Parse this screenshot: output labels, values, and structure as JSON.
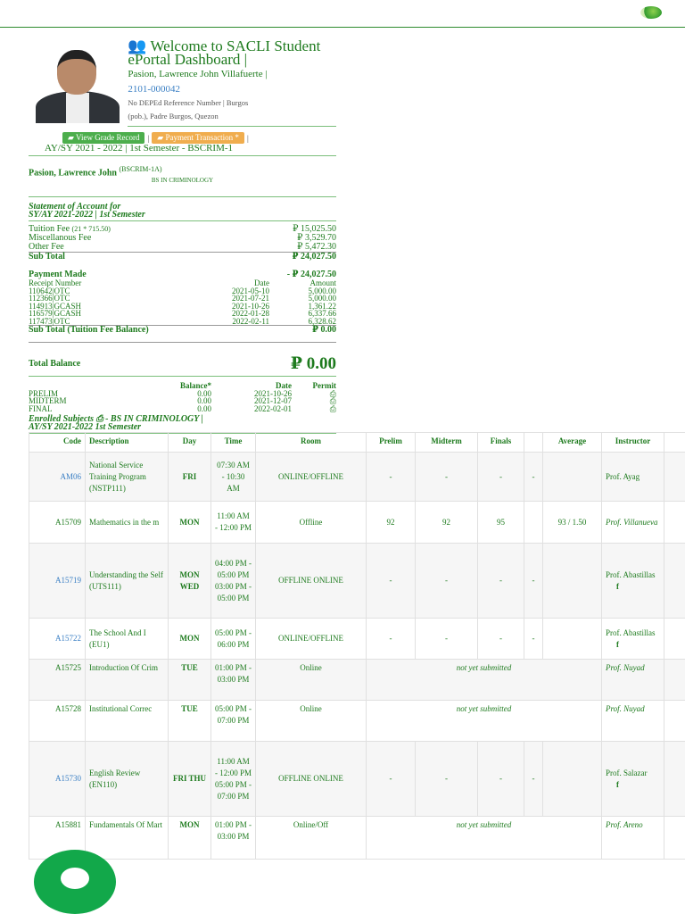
{
  "header": {
    "logo": "SACLI logo"
  },
  "profile": {
    "welcome": "Welcome to SACLI Student ePortal Dashboard |",
    "name": "Pasion, Lawrence John Villafuerte |",
    "student_id": "2101-000042",
    "address_line1": "No DEPEd Reference Number | Burgos",
    "address_line2": "(pob.), Padre Burgos, Quezon"
  },
  "buttons": {
    "grade": "View Grade Record",
    "payment": "Payment Transaction *"
  },
  "ay": "AY/SY 2021 - 2022 | 1st Semester - BSCRIM-1",
  "student": {
    "name": "Pasion, Lawrence John",
    "section": "(BSCRIM-1A)",
    "course": "BS IN CRIMINOLOGY"
  },
  "soa": {
    "title1": "Statement of Account for",
    "title2": "SY/AY 2021-2022 | 1st Semester",
    "fees": [
      {
        "label": "Tuition Fee",
        "note": "(21 * 715.50)",
        "amount": "₽ 15,025.50"
      },
      {
        "label": "Miscellanous Fee",
        "note": "",
        "amount": "₽ 3,529.70"
      },
      {
        "label": "Other Fee",
        "note": "",
        "amount": "₽ 5,472.30"
      }
    ],
    "subtotal_label": "Sub Total",
    "subtotal": "₽ 24,027.50",
    "payment_label": "Payment Made",
    "payment_total": "-  ₽ 24,027.50",
    "payment_headers": [
      "Receipt Number",
      "Date",
      "Amount"
    ],
    "payments": [
      [
        "110642|OTC",
        "2021-05-10",
        "5,000.00"
      ],
      [
        "112366|OTC",
        "2021-07-21",
        "5,000.00"
      ],
      [
        "114913|GCASH",
        "2021-10-26",
        "1,361.22"
      ],
      [
        "116579|GCASH",
        "2022-01-28",
        "6,337.66"
      ],
      [
        "117473|OTC",
        "2022-02-11",
        "6,328.62"
      ]
    ],
    "balance_sub_label": "Sub Total (Tuition Fee Balance)",
    "balance_sub": "₽ 0.00",
    "total_label": "Total Balance",
    "total": "₽  0.00",
    "exam_headers": [
      "",
      "Balance*",
      "Date",
      "Permit"
    ],
    "exams": [
      [
        "PRELIM",
        "0.00",
        "2021-10-26"
      ],
      [
        "MIDTERM",
        "0.00",
        "2021-12-07"
      ],
      [
        "FINAL",
        "0.00",
        "2022-02-01"
      ]
    ]
  },
  "enrolled": {
    "title1": "Enrolled Subjects",
    "title1b": "- BS IN CRIMINOLOGY |",
    "title2": "AY/SY 2021-2022 1st Semester",
    "headers": [
      "Code",
      "Description",
      "Day",
      "Time",
      "Room",
      "Prelim",
      "Midterm",
      "Finals",
      "",
      "Average",
      "Instructor"
    ],
    "rows": [
      {
        "code": "AM06",
        "desc": "National Service Training Program (NSTP111)",
        "day": "FRI",
        "time": "07:30 AM - 10:30 AM",
        "room": "ONLINE/OFFLINE",
        "prelim": "-",
        "midterm": "-",
        "finals": "-",
        "x": "-",
        "avg": "",
        "instr": "Prof. Ayag"
      },
      {
        "code": "A15709",
        "desc": "Mathematics in the m",
        "day": "MON",
        "time": "11:00 AM - 12:00 PM",
        "room": "Offline",
        "prelim": "92",
        "midterm": "92",
        "finals": "95",
        "x": "",
        "avg": "93 / 1.50",
        "instr": "Prof. Villanueva"
      },
      {
        "code": "A15719",
        "desc": "Understanding the Self (UTS111)",
        "day": "MON WED",
        "time": "04:00 PM - 05:00 PM 03:00 PM - 05:00 PM",
        "room": "OFFLINE ONLINE",
        "prelim": "-",
        "midterm": "-",
        "finals": "-",
        "x": "-",
        "avg": "",
        "instr": "Prof. Abastillas"
      },
      {
        "code": "A15722",
        "desc": "The School And I (EU1)",
        "day": "MON",
        "time": "05:00 PM - 06:00 PM",
        "room": "ONLINE/OFFLINE",
        "prelim": "-",
        "midterm": "-",
        "finals": "-",
        "x": "-",
        "avg": "",
        "instr": "Prof. Abastillas"
      },
      {
        "code": "A15725",
        "desc": "Introduction Of Crim",
        "day": "TUE",
        "time": "01:00 PM - 03:00 PM",
        "room": "Online",
        "status": "not yet submitted",
        "instr": "Prof. Nuyad"
      },
      {
        "code": "A15728",
        "desc": "Institutional Correc",
        "day": "TUE",
        "time": "05:00 PM - 07:00 PM",
        "room": "Online",
        "status": "not yet submitted",
        "instr": "Prof. Nuyad"
      },
      {
        "code": "A15730",
        "desc": "English Review (EN110)",
        "day": "FRI THU",
        "time": "11:00 AM - 12:00 PM 05:00 PM - 07:00 PM",
        "room": "OFFLINE ONLINE",
        "prelim": "-",
        "midterm": "-",
        "finals": "-",
        "x": "-",
        "avg": "",
        "instr": "Prof. Salazar"
      },
      {
        "code": "A15881",
        "desc": "Fundamentals Of Mart",
        "day": "MON",
        "time": "01:00 PM - 03:00 PM",
        "room": "Online/Off",
        "status": "not yet submitted",
        "instr": "Prof. Areno"
      }
    ]
  }
}
